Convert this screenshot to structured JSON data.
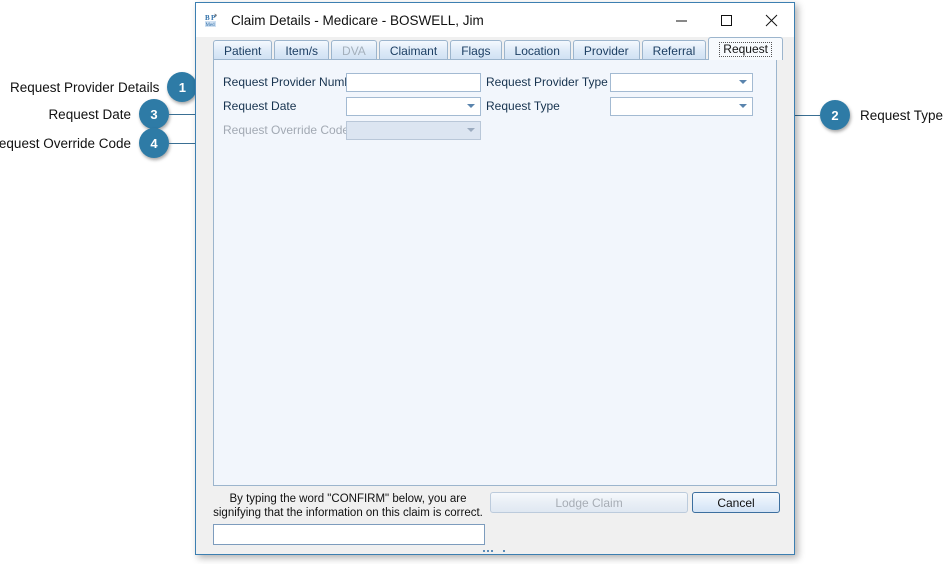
{
  "window": {
    "title": "Claim Details - Medicare - BOSWELL, Jim",
    "icon": "app-logo-icon",
    "controls": {
      "minimize": "Minimize",
      "maximize": "Maximize",
      "close": "Close"
    }
  },
  "tabs": [
    {
      "label": "Patient",
      "state": "enabled"
    },
    {
      "label": "Item/s",
      "state": "enabled"
    },
    {
      "label": "DVA",
      "state": "disabled"
    },
    {
      "label": "Claimant",
      "state": "enabled"
    },
    {
      "label": "Flags",
      "state": "enabled"
    },
    {
      "label": "Location",
      "state": "enabled"
    },
    {
      "label": "Provider",
      "state": "enabled"
    },
    {
      "label": "Referral",
      "state": "enabled"
    },
    {
      "label": "Request",
      "state": "active"
    }
  ],
  "form": {
    "request_provider_number": {
      "label": "Request Provider Number",
      "value": "",
      "type": "text"
    },
    "request_provider_type": {
      "label": "Request Provider Type",
      "value": "",
      "type": "combo"
    },
    "request_date": {
      "label": "Request Date",
      "value": "",
      "type": "combo"
    },
    "request_type": {
      "label": "Request Type",
      "value": "",
      "type": "combo"
    },
    "request_override_code": {
      "label": "Request Override Code",
      "value": "",
      "type": "combo",
      "state": "disabled"
    }
  },
  "bottom": {
    "confirm_note_line1": "By typing the word \"CONFIRM\" below, you are",
    "confirm_note_line2": "signifying that the information on this claim is correct.",
    "confirm_value": "",
    "lodge_label": "Lodge Claim",
    "cancel_label": "Cancel"
  },
  "annotations": [
    {
      "number": "1",
      "label": "Request Provider Details"
    },
    {
      "number": "3",
      "label": "Request Date"
    },
    {
      "number": "4",
      "label": "Request Override Code"
    },
    {
      "number": "2",
      "label": "Request Type"
    }
  ],
  "colors": {
    "badge": "#2e7ba6",
    "leader": "#3a6f93",
    "window_border": "#3c7fb1",
    "panel_bg": "#f2f6fc",
    "tab_text": "#1d3f63"
  }
}
